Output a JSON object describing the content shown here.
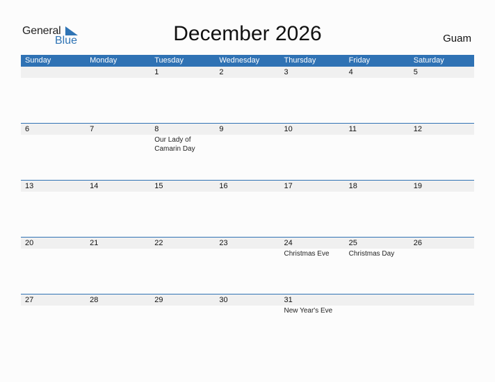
{
  "logo": {
    "line1": "General",
    "line2": "Blue",
    "brand_color": "#2f74b5"
  },
  "title": "December 2026",
  "region": "Guam",
  "header_color": "#2f72b4",
  "weekdays": [
    "Sunday",
    "Monday",
    "Tuesday",
    "Wednesday",
    "Thursday",
    "Friday",
    "Saturday"
  ],
  "weeks": [
    [
      {
        "day": ""
      },
      {
        "day": ""
      },
      {
        "day": "1"
      },
      {
        "day": "2"
      },
      {
        "day": "3"
      },
      {
        "day": "4"
      },
      {
        "day": "5"
      }
    ],
    [
      {
        "day": "6"
      },
      {
        "day": "7"
      },
      {
        "day": "8",
        "holiday": "Our Lady of Camarin Day"
      },
      {
        "day": "9"
      },
      {
        "day": "10"
      },
      {
        "day": "11"
      },
      {
        "day": "12"
      }
    ],
    [
      {
        "day": "13"
      },
      {
        "day": "14"
      },
      {
        "day": "15"
      },
      {
        "day": "16"
      },
      {
        "day": "17"
      },
      {
        "day": "18"
      },
      {
        "day": "19"
      }
    ],
    [
      {
        "day": "20"
      },
      {
        "day": "21"
      },
      {
        "day": "22"
      },
      {
        "day": "23"
      },
      {
        "day": "24",
        "holiday": "Christmas Eve"
      },
      {
        "day": "25",
        "holiday": "Christmas Day"
      },
      {
        "day": "26"
      }
    ],
    [
      {
        "day": "27"
      },
      {
        "day": "28"
      },
      {
        "day": "29"
      },
      {
        "day": "30"
      },
      {
        "day": "31",
        "holiday": "New Year's Eve"
      },
      {
        "day": ""
      },
      {
        "day": ""
      }
    ]
  ]
}
